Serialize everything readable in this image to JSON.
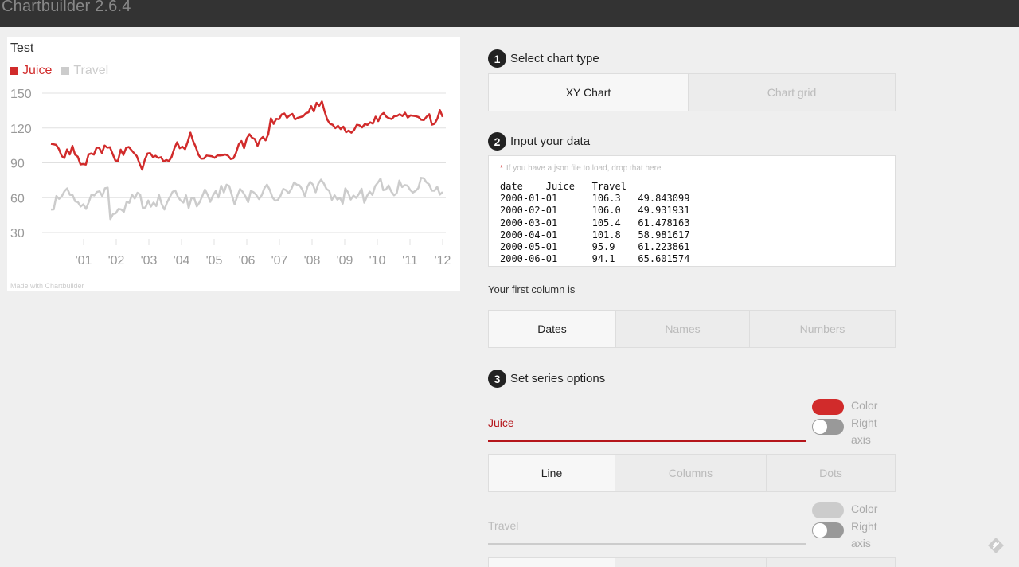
{
  "app": {
    "title": "Chartbuilder 2.6.4"
  },
  "chart": {
    "title": "Test",
    "credit": "Made with Chartbuilder",
    "colors": {
      "juice": "#d12b2b",
      "travel": "#cccccc",
      "grid": "#e0e0e0",
      "tick_text": "#999999"
    }
  },
  "chart_data": {
    "type": "line",
    "title": "Test",
    "xlabel": "",
    "ylabel": "",
    "ylim": [
      30,
      150
    ],
    "yticks": [
      "150",
      "120",
      "90",
      "60",
      "30"
    ],
    "xticks": [
      "'01",
      "'02",
      "'03",
      "'04",
      "'05",
      "'06",
      "'07",
      "'08",
      "'09",
      "'10",
      "'11",
      "'12"
    ],
    "x_range": [
      "2000-01-01",
      "2011-12-01"
    ],
    "grid": true,
    "legend_position": "top-left",
    "series": [
      {
        "name": "Juice",
        "color": "#d12b2b",
        "values": [
          106.3,
          106.0,
          105.4,
          101.8,
          95.9,
          94.1,
          101.5,
          97.2,
          104.6,
          97.0,
          95.3,
          88.6,
          89.0,
          88.5,
          97.3,
          98.1,
          97.1,
          103.2,
          102.8,
          98.5,
          104.9,
          103.1,
          103.5,
          97.7,
          92.0,
          91.8,
          101.4,
          96.8,
          102.9,
          103.7,
          101.0,
          98.2,
          95.8,
          89.5,
          84.2,
          92.6,
          98.1,
          98.4,
          95.0,
          96.1,
          94.2,
          94.9,
          91.2,
          92.5,
          91.6,
          95.3,
          102.4,
          107.7,
          102.6,
          103.9,
          101.8,
          108.4,
          116.0,
          108.7,
          103.5,
          96.9,
          93.6,
          93.8,
          96.3,
          96.0,
          95.7,
          94.3,
          96.3,
          96.3,
          96.6,
          97.2,
          96.2,
          93.3,
          93.9,
          98.7,
          105.9,
          108.8,
          102.6,
          111.1,
          114.6,
          111.6,
          110.5,
          104.7,
          110.1,
          112.2,
          109.4,
          114.7,
          128.3,
          123.5,
          127.9,
          127.5,
          131.7,
          132.5,
          128.8,
          131.0,
          132.2,
          127.4,
          128.8,
          129.4,
          130.1,
          132.6,
          133.5,
          138.8,
          134.2,
          141.7,
          139.2,
          142.9,
          134.3,
          127.2,
          123.7,
          122.8,
          119.9,
          121.9,
          119.1,
          121.1,
          116.3,
          117.8,
          116.0,
          118.3,
          122.8,
          122.4,
          120.5,
          123.4,
          122.7,
          124.9,
          123.8,
          129.8,
          125.9,
          131.1,
          132.9,
          129.8,
          128.5,
          127.7,
          130.2,
          130.4,
          131.9,
          130.3,
          133.1,
          129.0,
          130.9,
          130.5,
          130.2,
          129.4,
          127.1,
          126.8,
          129.7,
          131.9,
          122.9,
          123.7,
          127.9,
          135.4,
          129.6
        ]
      },
      {
        "name": "Travel",
        "color": "#cccccc",
        "values": [
          49.8,
          49.9,
          61.5,
          59.0,
          61.2,
          65.6,
          68.0,
          62.5,
          62.3,
          56.8,
          56.1,
          52.4,
          54.3,
          50.4,
          56.2,
          62.7,
          61.9,
          64.9,
          65.5,
          61.3,
          68.2,
          68.6,
          41.6,
          45.9,
          46.5,
          50.3,
          49.9,
          47.9,
          56.3,
          55.6,
          62.6,
          59.3,
          64.2,
          62.7,
          51.1,
          51.6,
          57.6,
          52.3,
          55.8,
          52.8,
          62.3,
          54.5,
          49.8,
          55.9,
          60.5,
          65.0,
          66.2,
          60.7,
          57.6,
          55.8,
          62.0,
          51.1,
          59.4,
          59.8,
          52.5,
          55.9,
          61.1,
          67.0,
          62.5,
          56.4,
          62.0,
          65.7,
          60.2,
          70.3,
          64.5,
          71.2,
          70.1,
          62.1,
          54.3,
          61.4,
          67.5,
          65.0,
          61.2,
          56.1,
          65.8,
          64.7,
          62.4,
          58.8,
          62.0,
          68.2,
          71.3,
          66.9,
          60.3,
          57.4,
          58.0,
          61.7,
          67.6,
          66.5,
          63.9,
          67.5,
          73.1,
          71.2,
          70.7,
          67.2,
          61.3,
          69.6,
          73.6,
          71.2,
          64.6,
          72.2,
          75.5,
          72.4,
          67.5,
          66.0,
          58.1,
          62.0,
          58.4,
          59.8,
          54.9,
          68.0,
          64.5,
          58.4,
          61.8,
          59.8,
          63.1,
          67.7,
          55.7,
          61.5,
          65.2,
          62.4,
          69.9,
          72.9,
          76.4,
          66.5,
          67.0,
          70.6,
          65.3,
          62.1,
          63.8,
          74.7,
          69.2,
          70.9,
          70.4,
          66.6,
          64.4,
          65.9,
          68.3,
          77.1,
          76.8,
          73.3,
          71.5,
          66.1,
          66.0,
          69.4,
          62.7,
          64.9
        ]
      }
    ]
  },
  "steps": [
    {
      "num": "1",
      "title": "Select chart type"
    },
    {
      "num": "2",
      "title": "Input your data"
    },
    {
      "num": "3",
      "title": "Set series options"
    }
  ],
  "chart_type": {
    "options": [
      "XY Chart",
      "Chart grid"
    ],
    "selected": "XY Chart"
  },
  "data_input": {
    "hint": "If you have a json file to load, drop that here",
    "text": "date\tJuice\tTravel\n2000-01-01\t106.3\t49.843099\n2000-02-01\t106.0\t49.931931\n2000-03-01\t105.4\t61.478163\n2000-04-01\t101.8\t58.981617\n2000-05-01\t95.9\t61.223861\n2000-06-01\t94.1\t65.601574"
  },
  "first_column": {
    "label": "Your first column is",
    "options": [
      "Dates",
      "Names",
      "Numbers"
    ],
    "selected": "Dates"
  },
  "series_options": [
    {
      "name": "Juice",
      "color": "#d12b2b",
      "color_label": "Color",
      "axis_label": "Right axis",
      "types": [
        "Line",
        "Columns",
        "Dots"
      ],
      "selected_type": "Line"
    },
    {
      "name": "Travel",
      "color": "#cccccc",
      "color_label": "Color",
      "axis_label": "Right axis"
    }
  ]
}
